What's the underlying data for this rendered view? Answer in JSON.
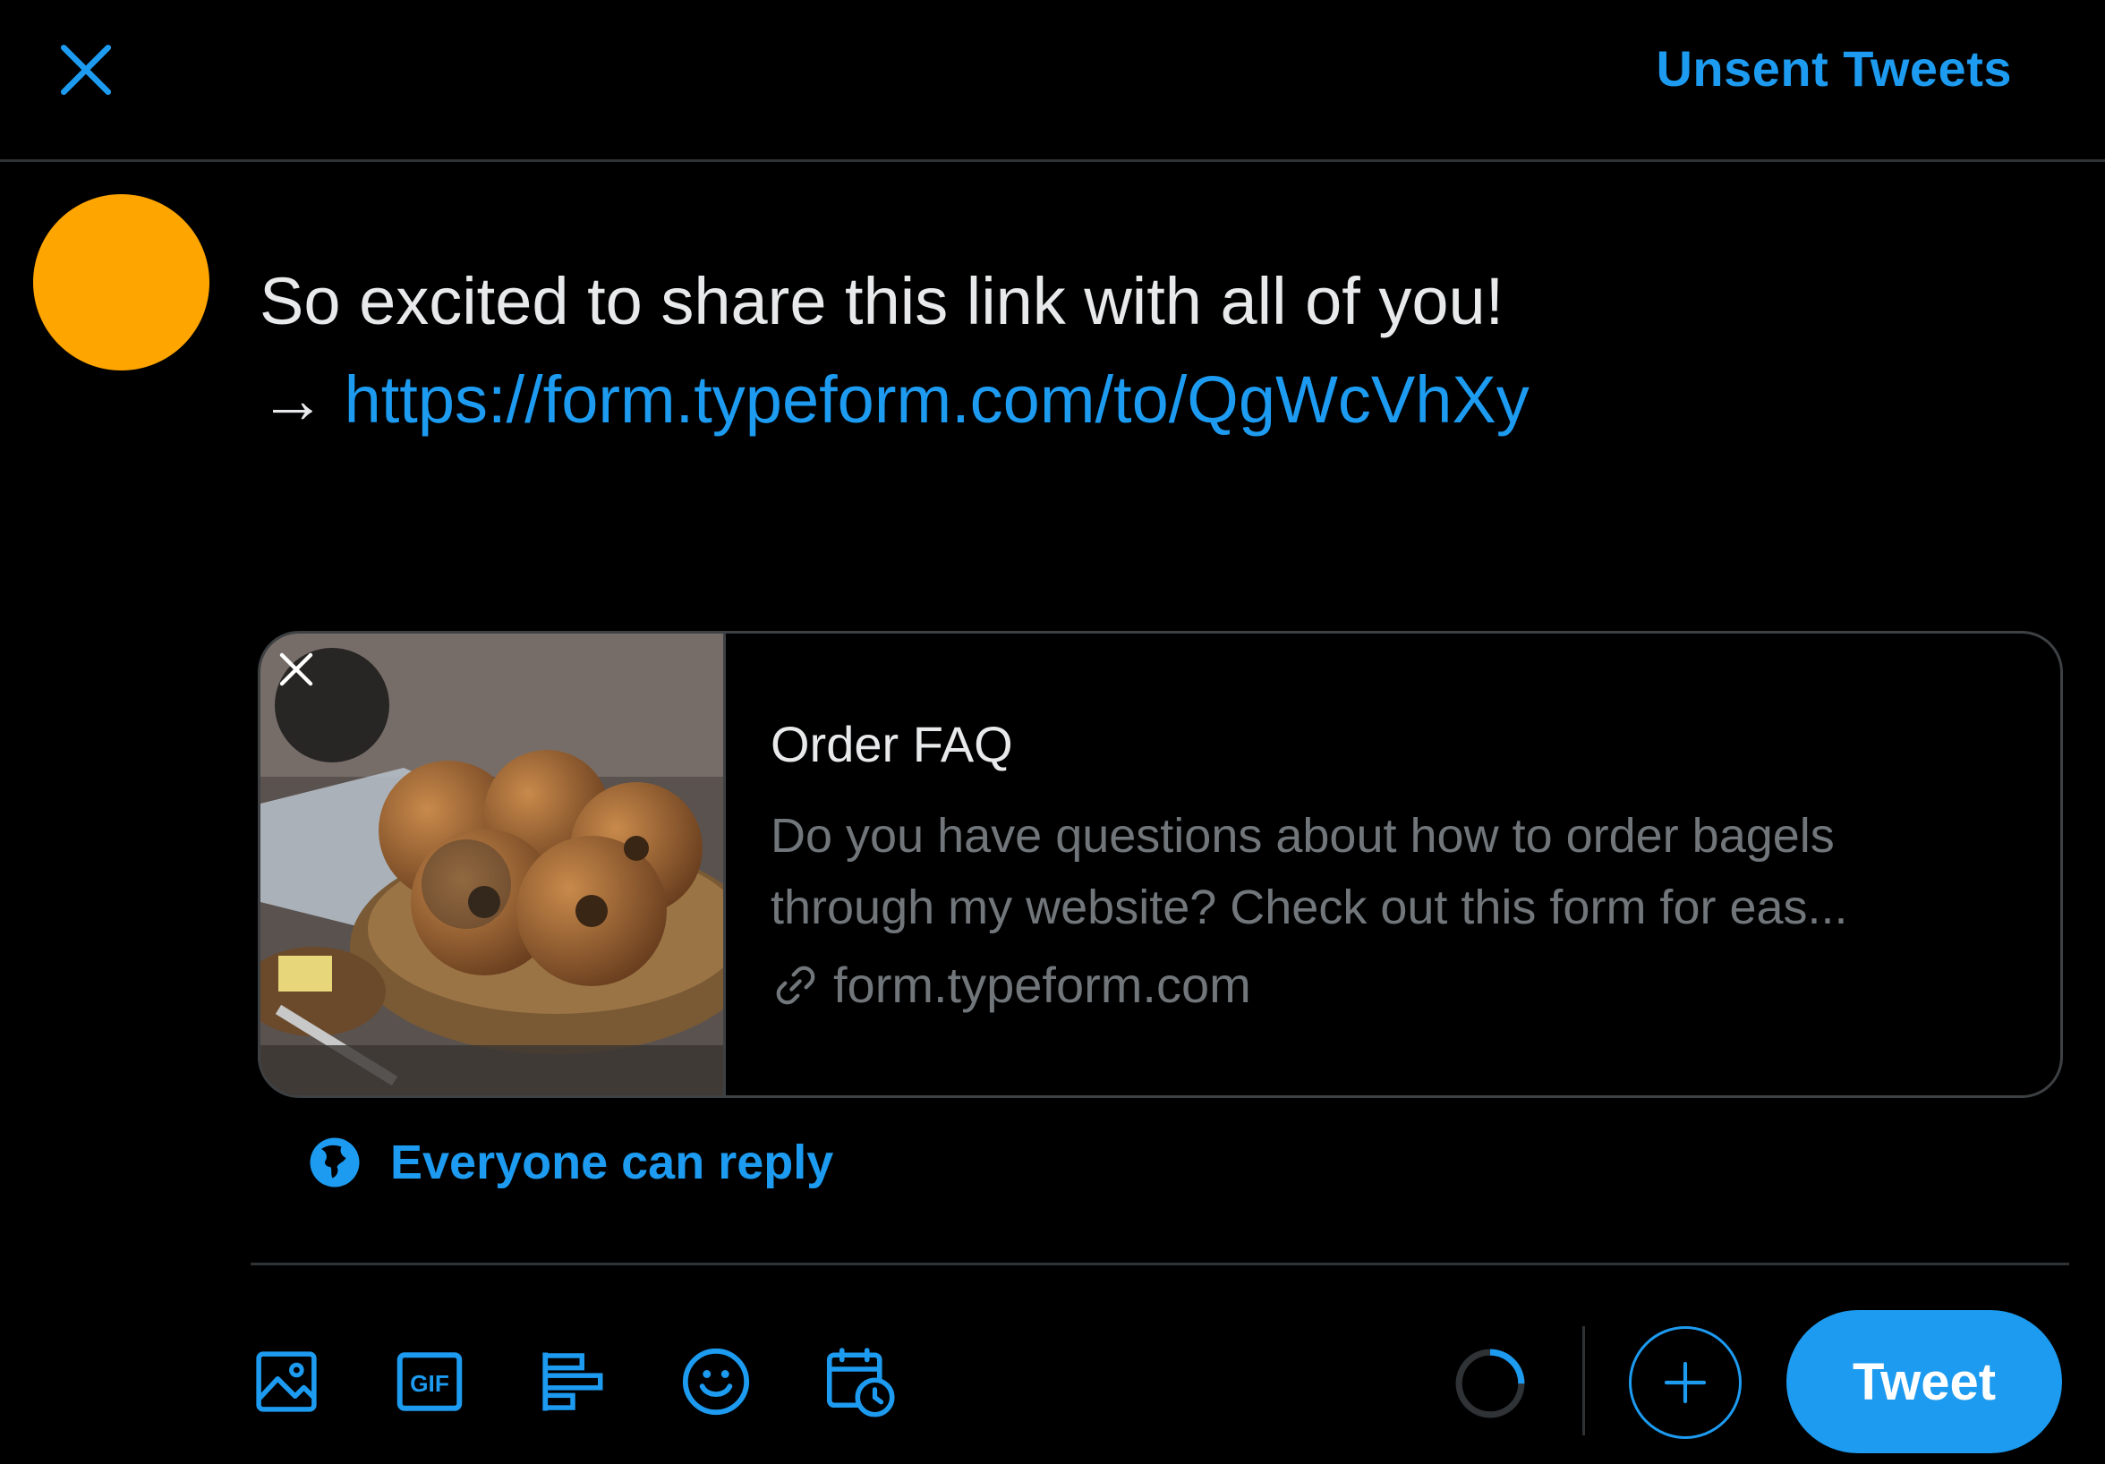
{
  "header": {
    "close_icon": "close-icon",
    "unsent_tweets_label": "Unsent Tweets"
  },
  "avatar": {
    "color": "#ffa500"
  },
  "compose": {
    "line1": "So excited to share this link with all of you!",
    "arrow": "→",
    "link": "https://form.typeform.com/to/QgWcVhXy"
  },
  "card": {
    "title": "Order FAQ",
    "description": "Do you have questions about how to order bagels through my website? Check out this form for eas...",
    "domain": "form.typeform.com",
    "remove_icon": "close-icon",
    "thumbnail": "bagels-photo"
  },
  "reply_setting": {
    "icon": "globe-icon",
    "label": "Everyone can reply"
  },
  "toolbar": {
    "icons": [
      "image-icon",
      "gif-icon",
      "poll-icon",
      "emoji-icon",
      "schedule-icon"
    ],
    "gif_text": "GIF",
    "progress_fraction": 0.25,
    "add_icon": "plus-icon",
    "tweet_label": "Tweet"
  },
  "colors": {
    "accent": "#1d9bf0",
    "background": "#000000",
    "border": "#2f3336",
    "muted_text": "#71767b"
  }
}
